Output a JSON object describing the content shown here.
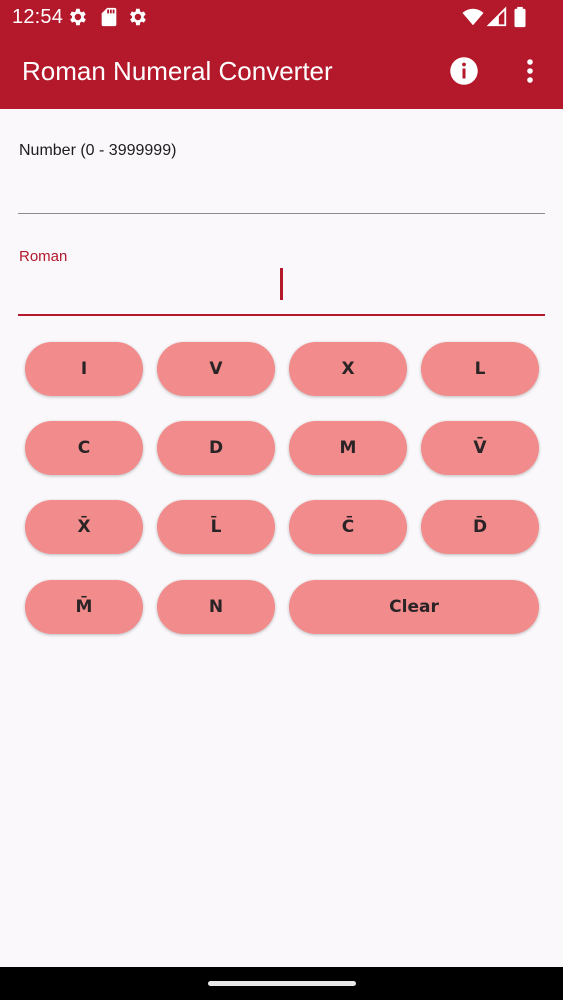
{
  "status_bar": {
    "time": "12:54",
    "left_icons": [
      "gear-icon",
      "sd-card-icon",
      "gear-icon"
    ],
    "right_icons": [
      "wifi-icon",
      "cellular-signal-icon",
      "battery-icon"
    ]
  },
  "app_bar": {
    "title": "Roman Numeral Converter",
    "actions": [
      "info-icon",
      "more-vert-icon"
    ]
  },
  "form": {
    "number_label": "Number (0 - 3999999)",
    "number_value": "",
    "roman_label": "Roman",
    "roman_value": ""
  },
  "keypad": {
    "rows": [
      [
        "I",
        "V",
        "X",
        "L"
      ],
      [
        "C",
        "D",
        "M",
        "V̄"
      ],
      [
        "X̄",
        "L̄",
        "C̄",
        "D̄"
      ],
      [
        "M̄",
        "N",
        "Clear"
      ]
    ]
  },
  "colors": {
    "primary": "#b3182b",
    "key_background": "#f28b8b",
    "background": "#faf8fa"
  }
}
